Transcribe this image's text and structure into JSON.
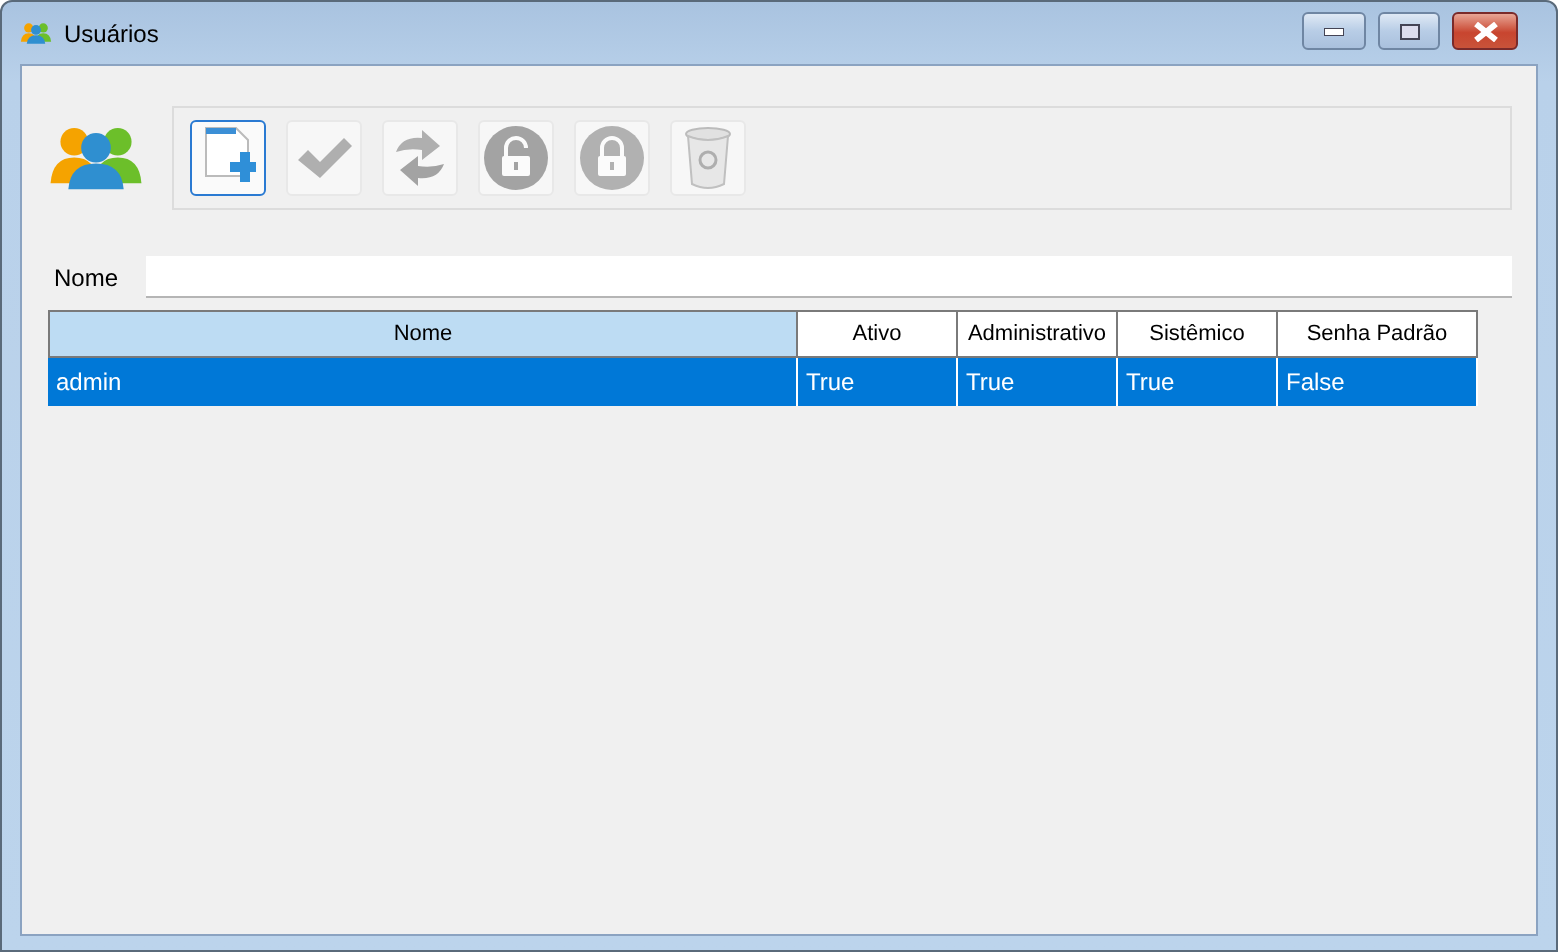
{
  "window": {
    "title": "Usuários"
  },
  "toolbar": [
    {
      "kind": "new",
      "selected": true,
      "disabled": false
    },
    {
      "kind": "confirm",
      "selected": false,
      "disabled": true
    },
    {
      "kind": "refresh",
      "selected": false,
      "disabled": true
    },
    {
      "kind": "unlock",
      "selected": false,
      "disabled": true
    },
    {
      "kind": "lock",
      "selected": false,
      "disabled": true
    },
    {
      "kind": "trash",
      "selected": false,
      "disabled": true
    }
  ],
  "filter": {
    "label": "Nome"
  },
  "table": {
    "columns": [
      {
        "label": "Nome",
        "selected": true
      },
      {
        "label": "Ativo",
        "selected": false
      },
      {
        "label": "Administrativo",
        "selected": false
      },
      {
        "label": "Sistêmico",
        "selected": false
      },
      {
        "label": "Senha Padrão",
        "selected": false
      }
    ],
    "rows": [
      {
        "selected": true,
        "cells": [
          "admin",
          "True",
          "True",
          "True",
          "False"
        ]
      }
    ]
  }
}
